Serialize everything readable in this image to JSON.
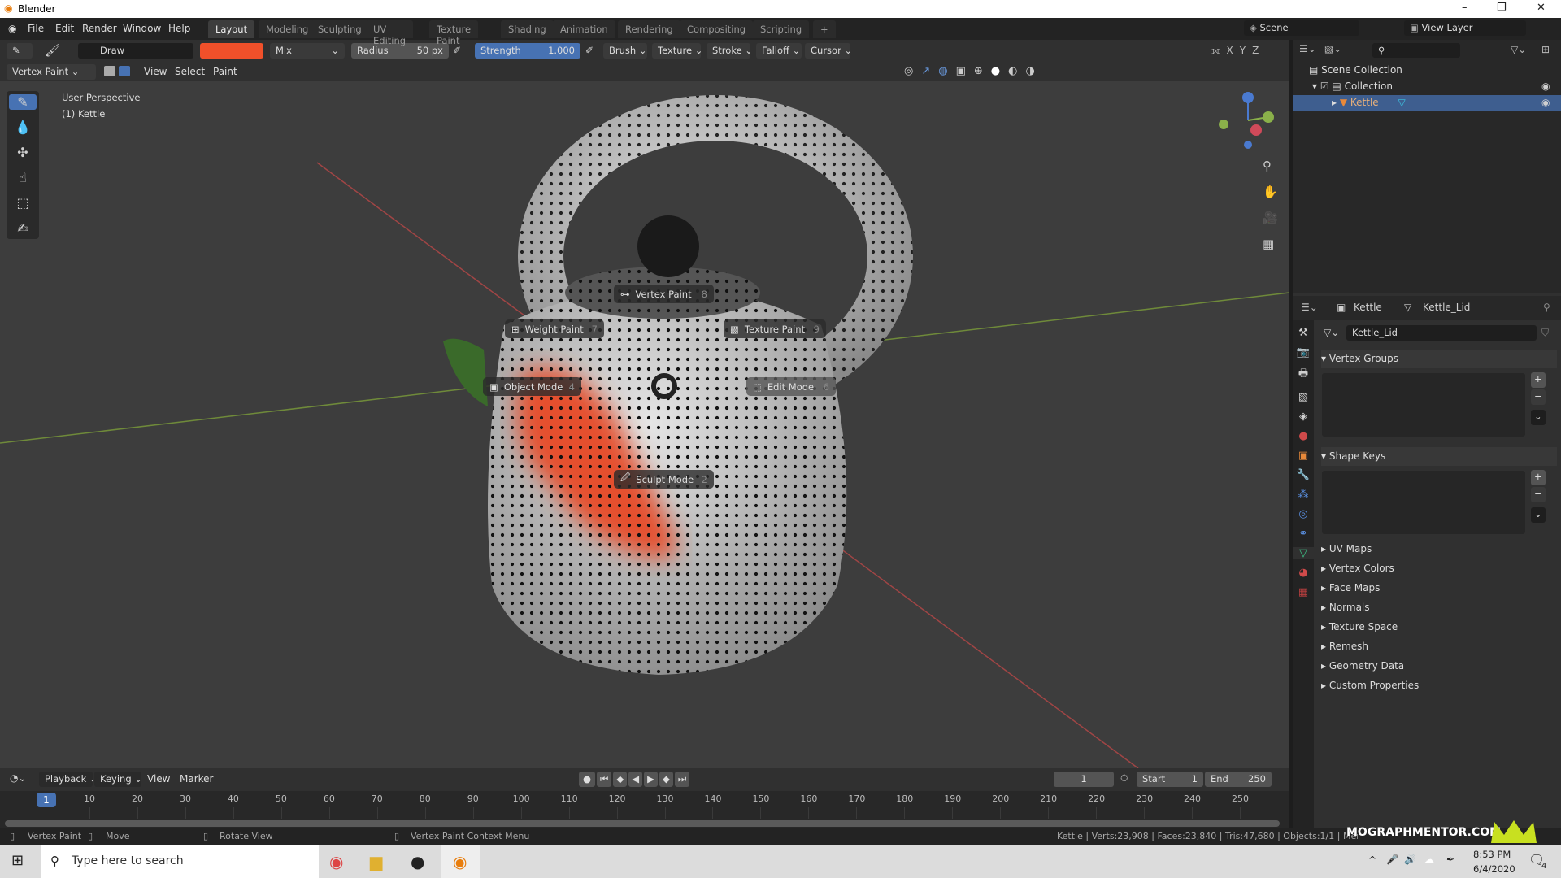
{
  "window": {
    "title": "Blender",
    "controls": [
      "–",
      "❐",
      "✕"
    ]
  },
  "menubar": {
    "items": [
      "File",
      "Edit",
      "Render",
      "Window",
      "Help"
    ],
    "workspaces": [
      "Layout",
      "Modeling",
      "Sculpting",
      "UV Editing",
      "Texture Paint",
      "Shading",
      "Animation",
      "Rendering",
      "Compositing",
      "Scripting"
    ],
    "active_workspace": "Layout",
    "add": "+",
    "scene": "Scene",
    "view_layer": "View Layer"
  },
  "toolheader": {
    "brush": "Draw",
    "color": "#f0502a",
    "blend": "Mix",
    "radius_label": "Radius",
    "radius_value": "50 px",
    "strength_label": "Strength",
    "strength_value": "1.000",
    "strength_fraction": 1.0,
    "menus": [
      "Brush",
      "Texture",
      "Stroke",
      "Falloff",
      "Cursor"
    ],
    "axes": [
      "X",
      "Y",
      "Z"
    ]
  },
  "viewport_header": {
    "mode": "Vertex Paint",
    "menus": [
      "View",
      "Select",
      "Paint"
    ]
  },
  "viewport": {
    "perspective": "User Perspective",
    "object": "(1) Kettle",
    "pie": [
      {
        "label": "Vertex Paint",
        "key": "8"
      },
      {
        "label": "Weight Paint",
        "key": "7"
      },
      {
        "label": "Texture Paint",
        "key": "9"
      },
      {
        "label": "Object Mode",
        "key": "4"
      },
      {
        "label": "Edit Mode",
        "key": "6"
      },
      {
        "label": "Sculpt Mode",
        "key": "2"
      }
    ],
    "paint_color": "#e5502e"
  },
  "outliner": {
    "root": "Scene Collection",
    "collection": "Collection",
    "object": "Kettle"
  },
  "properties": {
    "object": "Kettle",
    "data": "Kettle_Lid",
    "data_field": "Kettle_Lid",
    "panels_open": [
      "Vertex Groups",
      "Shape Keys"
    ],
    "panels_closed": [
      "UV Maps",
      "Vertex Colors",
      "Face Maps",
      "Normals",
      "Texture Space",
      "Remesh",
      "Geometry Data",
      "Custom Properties"
    ]
  },
  "timeline": {
    "menus": [
      "Playback",
      "Keying",
      "View",
      "Marker"
    ],
    "current_frame": "1",
    "start_label": "Start",
    "start": "1",
    "end_label": "End",
    "end": "250",
    "ticks": [
      "10",
      "20",
      "30",
      "40",
      "50",
      "60",
      "70",
      "80",
      "90",
      "100",
      "110",
      "120",
      "130",
      "140",
      "150",
      "160",
      "170",
      "180",
      "190",
      "200",
      "210",
      "220",
      "230",
      "240",
      "250"
    ]
  },
  "status": {
    "left": "Vertex Paint",
    "move": "Move",
    "rotate": "Rotate View",
    "context": "Vertex Paint Context Menu",
    "stats": "Kettle | Verts:23,908 | Faces:23,840 | Tris:47,680 | Objects:1/1 | Mem: 60.8 MiB",
    "watermark": "MOGRAPHMENTOR.COM"
  },
  "taskbar": {
    "search_placeholder": "Type here to search",
    "time": "8:53 PM",
    "date": "6/4/2020",
    "notifications": "4"
  }
}
